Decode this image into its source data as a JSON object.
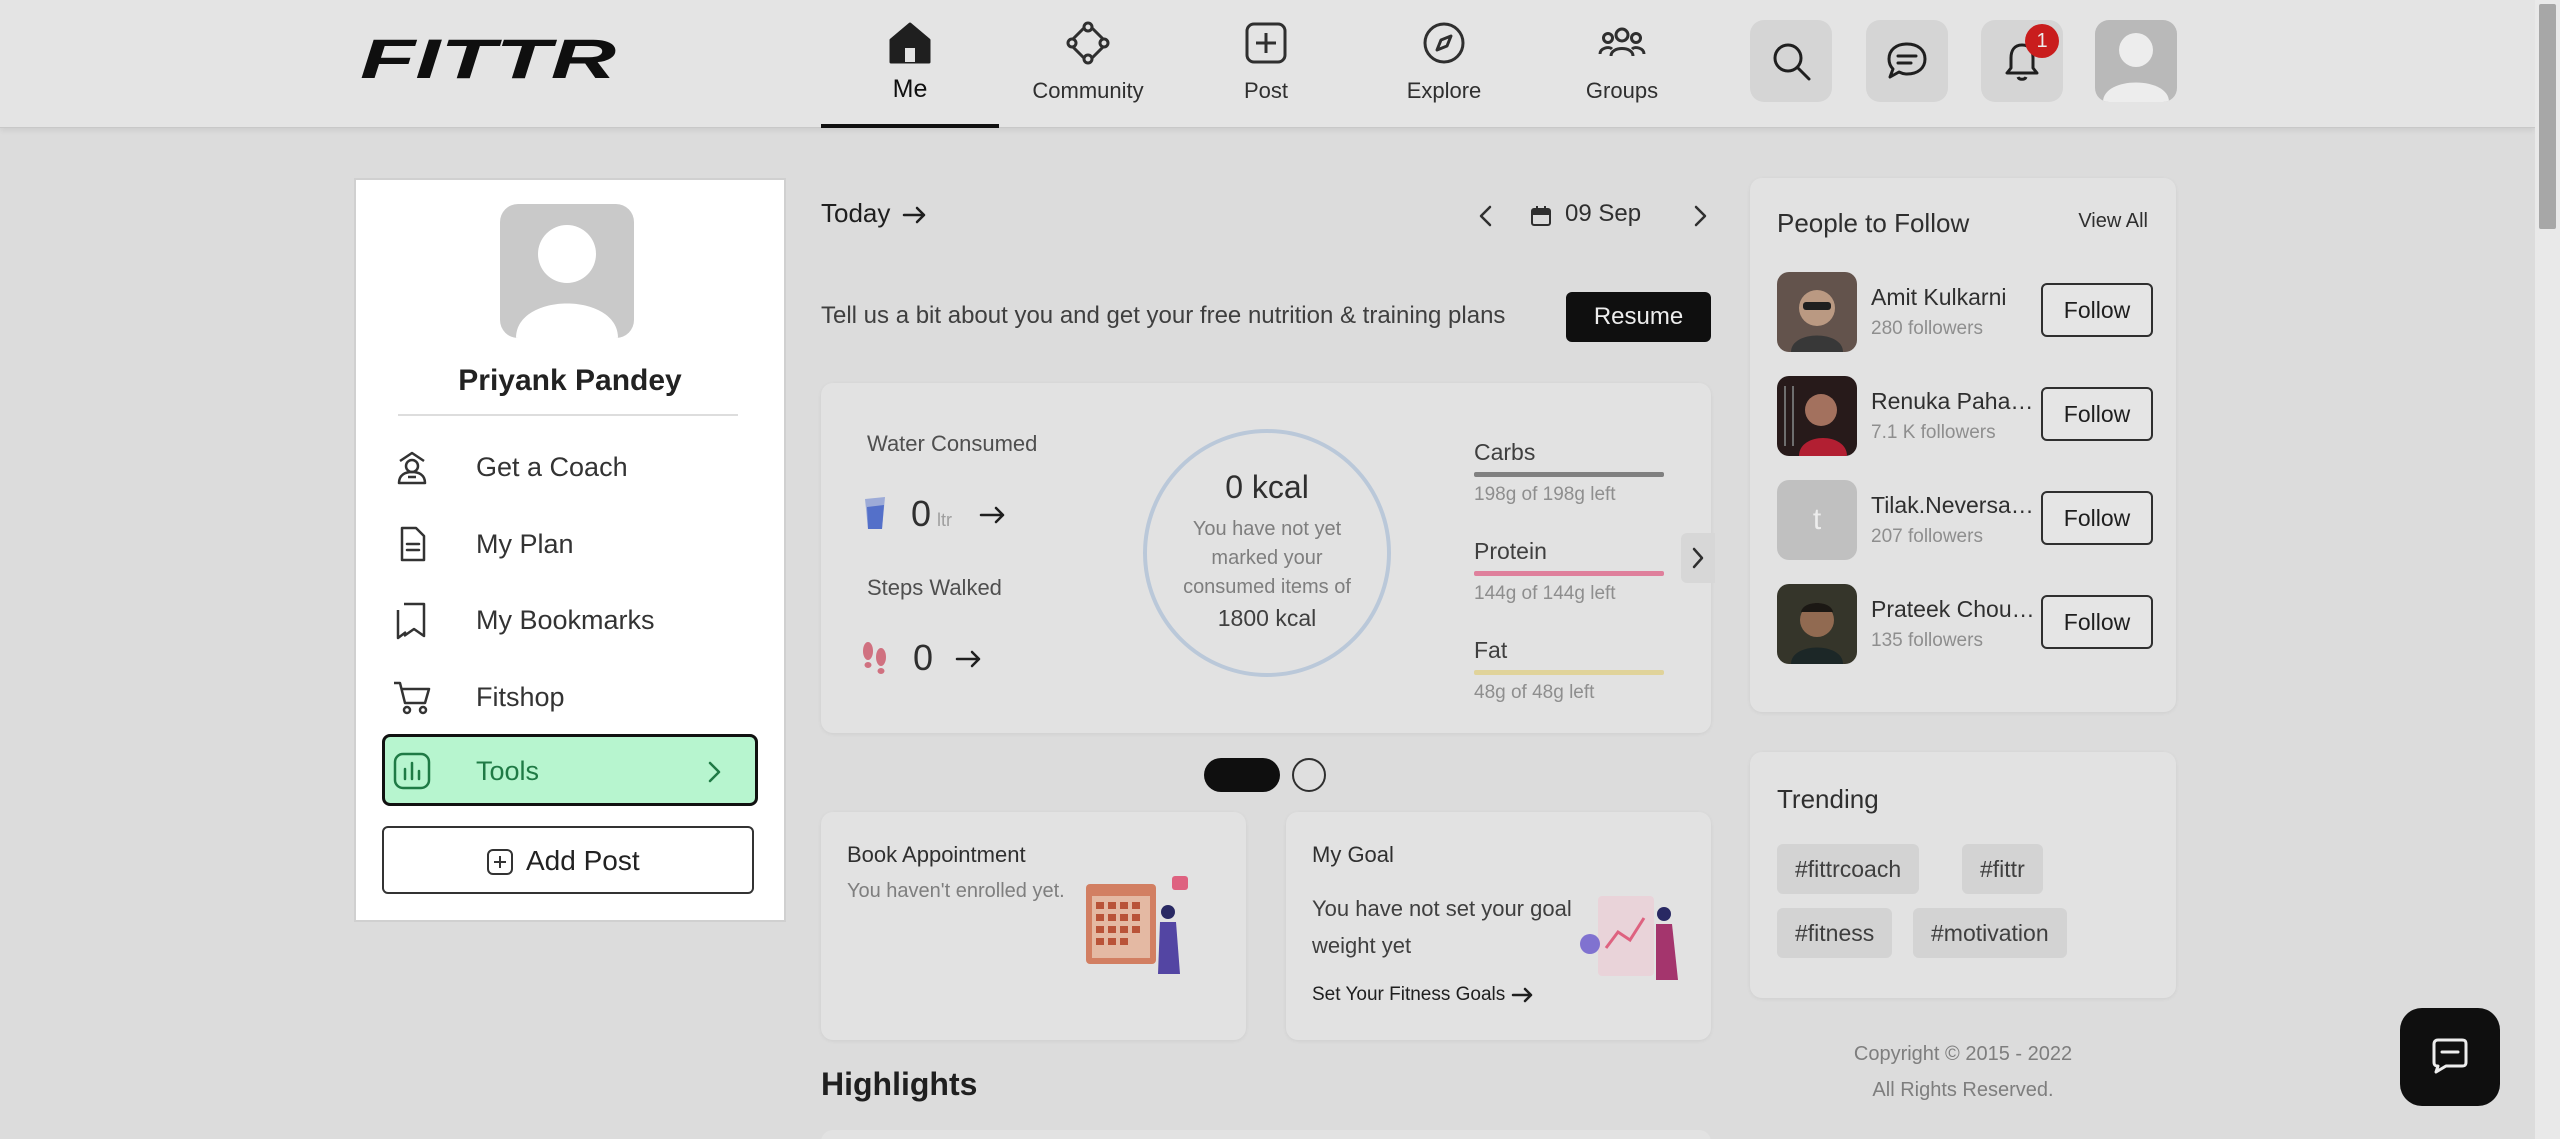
{
  "header": {
    "logo_text": "FITTR",
    "nav": [
      {
        "label": "Me",
        "icon": "home-icon",
        "active": true
      },
      {
        "label": "Community",
        "icon": "community-icon"
      },
      {
        "label": "Post",
        "icon": "plus-square-icon"
      },
      {
        "label": "Explore",
        "icon": "compass-icon"
      },
      {
        "label": "Groups",
        "icon": "groups-icon"
      }
    ],
    "notification_count": "1"
  },
  "profile": {
    "name": "Priyank Pandey",
    "menu": [
      {
        "label": "Get a Coach",
        "icon": "coach-icon"
      },
      {
        "label": "My Plan",
        "icon": "document-icon"
      },
      {
        "label": "My Bookmarks",
        "icon": "bookmarks-icon"
      },
      {
        "label": "Fitshop",
        "icon": "cart-icon"
      },
      {
        "label": "Tools",
        "icon": "bar-chart-icon",
        "active": true
      }
    ],
    "add_post_label": "Add Post"
  },
  "today": {
    "label": "Today",
    "date": "09 Sep",
    "onboarding_text": "Tell us a bit about you and get your free nutrition & training plans",
    "resume_label": "Resume"
  },
  "stats": {
    "water_title": "Water Consumed",
    "water_value": "0",
    "water_unit": "ltr",
    "steps_title": "Steps Walked",
    "steps_value": "0",
    "kcal_value": "0 kcal",
    "kcal_message": "You have not yet marked your consumed items of",
    "kcal_target": "1800 kcal",
    "macros": [
      {
        "name": "Carbs",
        "detail": "198g of 198g left",
        "color": "#8a8a8a"
      },
      {
        "name": "Protein",
        "detail": "144g of 144g left",
        "color": "#f08aa8"
      },
      {
        "name": "Fat",
        "detail": "48g of 48g left",
        "color": "#f2e4a6"
      }
    ]
  },
  "cards": {
    "appointment_title": "Book Appointment",
    "appointment_sub": "You haven't enrolled yet.",
    "goal_title": "My Goal",
    "goal_text": "You have not set your goal weight yet",
    "goal_link": "Set Your Fitness Goals"
  },
  "highlights_title": "Highlights",
  "people": {
    "title": "People to Follow",
    "view_all": "View All",
    "follow_label": "Follow",
    "list": [
      {
        "name": "Amit Kulkarni",
        "followers": "280 followers"
      },
      {
        "name": "Renuka Pahadsing",
        "followers": "7.1 K followers"
      },
      {
        "name": "Tilak.Neversaynever",
        "followers": "207 followers",
        "initial": "t"
      },
      {
        "name": "Prateek Chouhan",
        "followers": "135 followers"
      }
    ]
  },
  "trending": {
    "title": "Trending",
    "tags": [
      "#fittrcoach",
      "#fittr",
      "#fitness",
      "#motivation"
    ]
  },
  "footer": {
    "copyright": "Copyright © 2015 - 2022",
    "rights": "All Rights Reserved."
  }
}
